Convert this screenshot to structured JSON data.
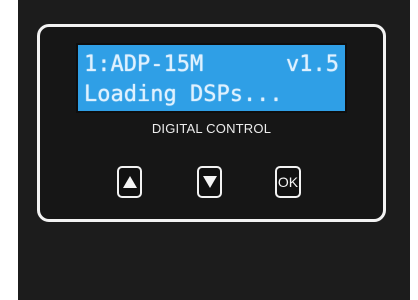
{
  "display": {
    "line1_model": "1:ADP-15M",
    "line1_version": "v1.5",
    "line2_status": "Loading DSPs...",
    "background_color": "#2f9fe6",
    "text_color": "#dff1ff"
  },
  "panel": {
    "label": "DIGITAL CONTROL"
  },
  "buttons": {
    "up_icon": "triangle-up-icon",
    "down_icon": "triangle-down-icon",
    "ok_label": "OK"
  },
  "colors": {
    "device_body": "#1c1c1c",
    "panel_border": "#f2f2f2"
  }
}
